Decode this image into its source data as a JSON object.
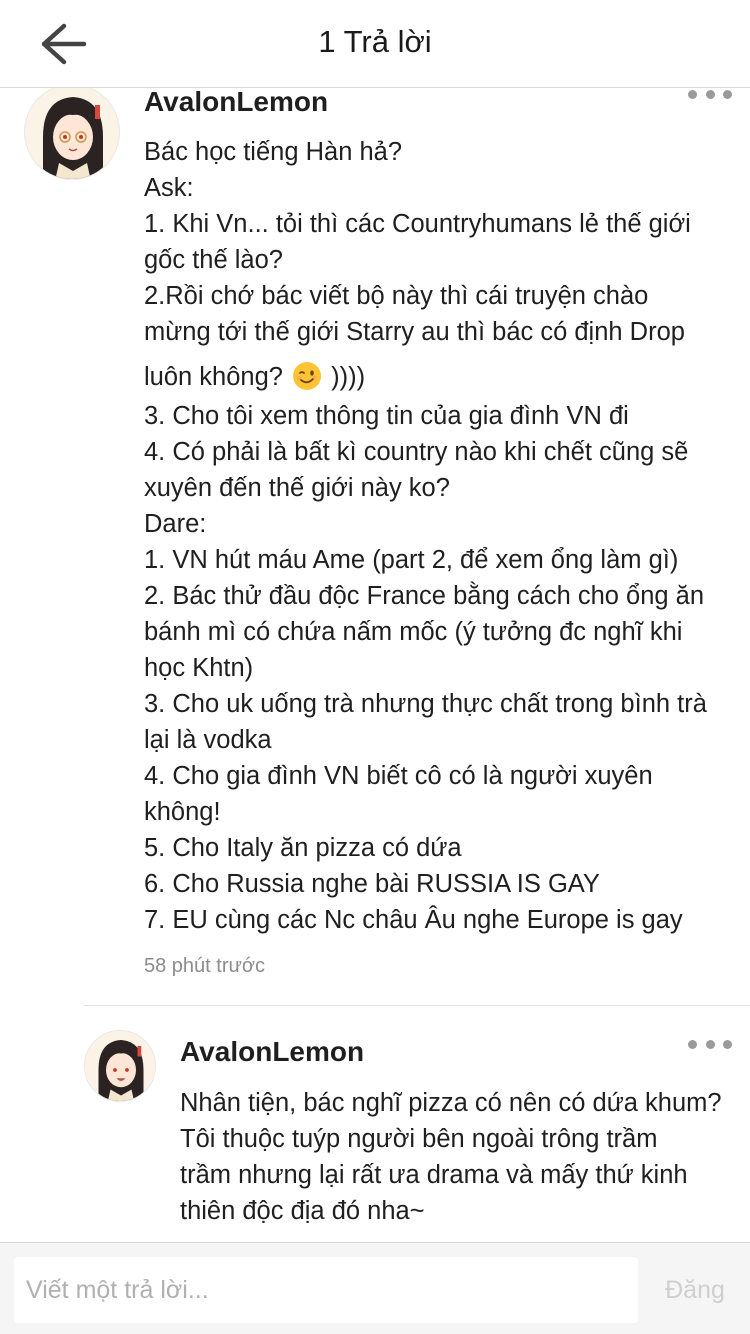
{
  "header": {
    "back_icon": "arrow-left-icon",
    "title": "1 Trả lời"
  },
  "comment": {
    "author": "AvalonLemon",
    "avatar_icon": "anime-girl-avatar",
    "lines_before_emoji": [
      "Bác học tiếng Hàn hả?",
      "Ask:",
      "1. Khi Vn... tỏi thì các Countryhumans lẻ thế giới",
      "gốc thế lào?",
      "2.Rồi chớ bác viết bộ này thì cái truyện chào",
      "mừng tới thế giới Starry au thì bác có định Drop"
    ],
    "emoji_line_before": "luôn không?",
    "emoji_icon": "winking-face-emoji",
    "emoji_line_after": "))))",
    "lines_after_emoji": [
      "3. Cho tôi xem thông tin của gia đình VN đi",
      "4. Có phải là bất kì country nào khi chết cũng sẽ",
      "xuyên đến thế giới này ko?",
      "Dare:",
      "1. VN hút máu Ame (part 2, để xem ổng làm gì)",
      "2. Bác thử đầu độc France bằng cách cho ổng ăn",
      "bánh mì có chứa nấm mốc (ý tưởng đc nghĩ khi",
      "học Khtn)",
      "3. Cho uk uống trà nhưng thực chất trong bình trà",
      "lại là vodka",
      "4. Cho gia đình VN biết cô có là người xuyên",
      "không!",
      "5. Cho Italy ăn pizza có dứa",
      "6. Cho Russia nghe bài RUSSIA IS GAY",
      "7. EU cùng các Nc châu Âu nghe Europe is gay"
    ],
    "timestamp": "58 phút trước",
    "more_icon": "more-dots-icon"
  },
  "reply": {
    "author": "AvalonLemon",
    "avatar_icon": "anime-girl-avatar",
    "lines": [
      "Nhân tiện, bác nghĩ pizza có nên có dứa khum?",
      "Tôi thuộc tuýp người bên ngoài trông trầm",
      "trầm nhưng lại rất ưa drama và mấy thứ kinh",
      "thiên độc địa đó nha~"
    ],
    "more_icon": "more-dots-icon"
  },
  "footer": {
    "input_placeholder": "Viết một trả lời...",
    "post_label": "Đăng"
  }
}
